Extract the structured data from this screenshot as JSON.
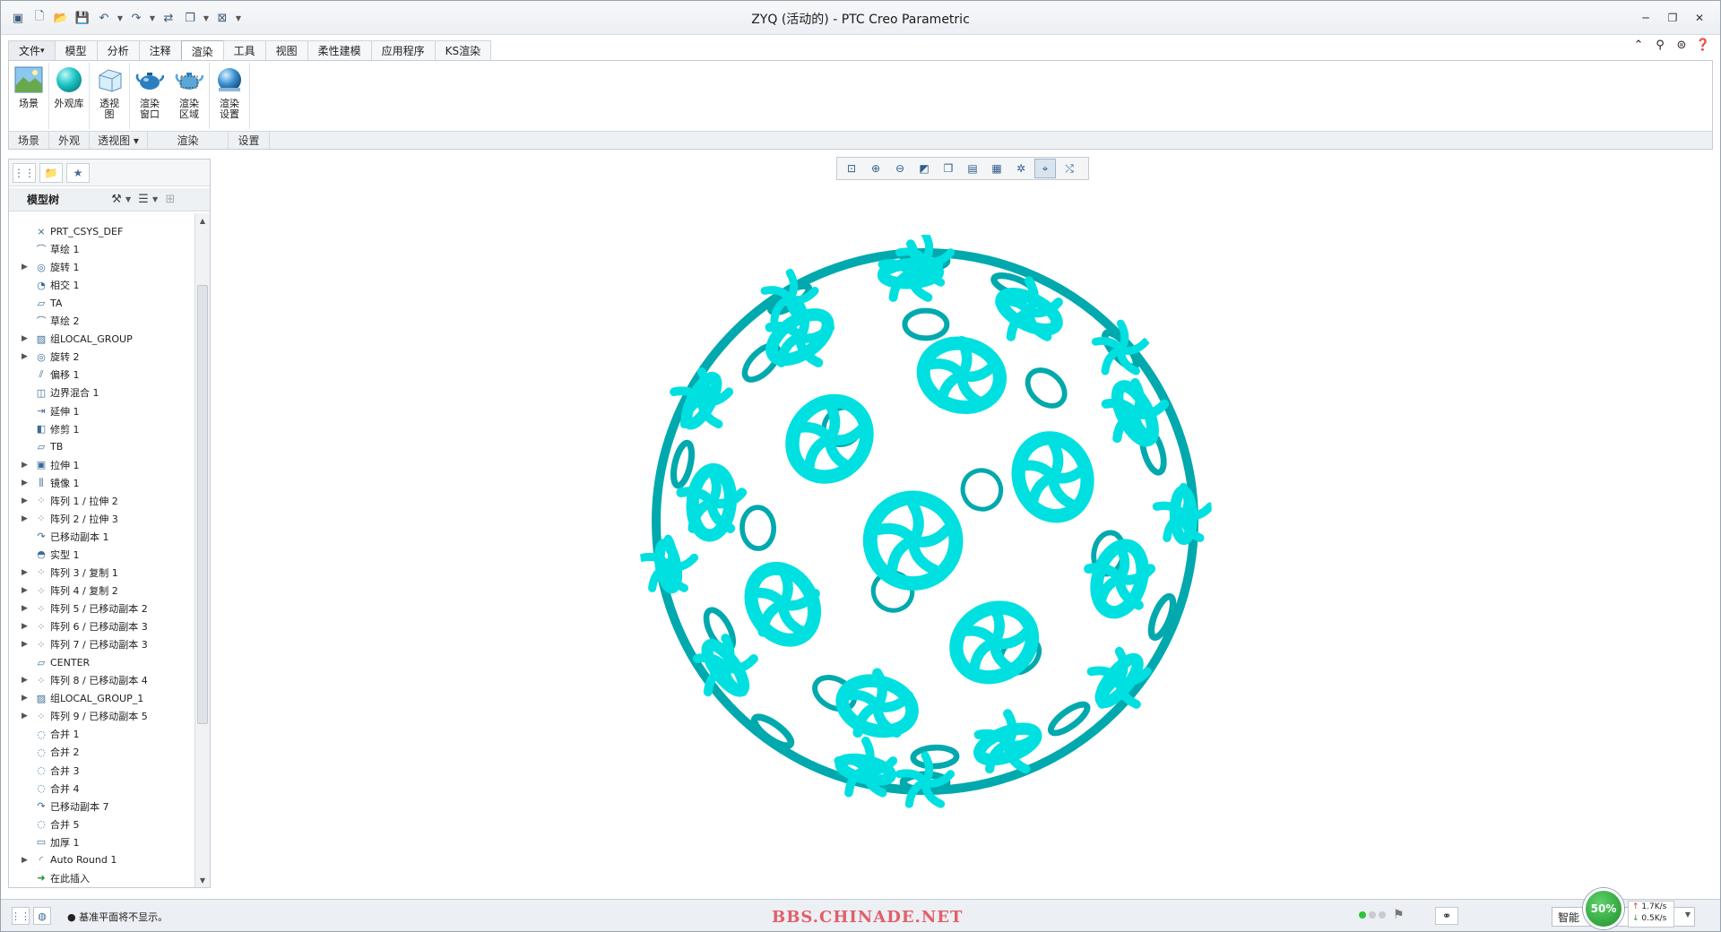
{
  "window": {
    "title": "ZYQ (活动的) - PTC Creo Parametric",
    "controls": [
      "minimize-icon",
      "restore-icon",
      "close-icon"
    ]
  },
  "quick_access": [
    "new-icon",
    "open-icon",
    "save-icon",
    "undo-icon",
    "redo-icon",
    "regenerate-icon",
    "windows-icon",
    "close-window-icon",
    "customize-icon"
  ],
  "tabs": [
    {
      "label": "文件",
      "dropdown": true
    },
    {
      "label": "模型"
    },
    {
      "label": "分析"
    },
    {
      "label": "注释"
    },
    {
      "label": "渲染",
      "active": true
    },
    {
      "label": "工具"
    },
    {
      "label": "视图"
    },
    {
      "label": "柔性建模"
    },
    {
      "label": "应用程序"
    },
    {
      "label": "KS渲染"
    }
  ],
  "ribbon": {
    "buttons": [
      {
        "label": "场景"
      },
      {
        "label": "外观库"
      },
      {
        "label": "透视\n图"
      },
      {
        "label": "渲染\n窗口"
      },
      {
        "label": "渲染\n区域"
      },
      {
        "label": "渲染\n设置"
      }
    ],
    "groups": [
      {
        "label": "场景"
      },
      {
        "label": "外观"
      },
      {
        "label": "透视图 ▾"
      },
      {
        "label": "渲染"
      },
      {
        "label": "设置"
      }
    ]
  },
  "model_tree": {
    "title": "模型树",
    "items": [
      {
        "label": "PRT_CSYS_DEF",
        "icon": "csys-icon",
        "expandable": false
      },
      {
        "label": "草绘 1",
        "icon": "sketch-icon",
        "expandable": false
      },
      {
        "label": "旋转 1",
        "icon": "revolve-icon",
        "expandable": true
      },
      {
        "label": "相交 1",
        "icon": "intersect-icon",
        "expandable": false
      },
      {
        "label": "TA",
        "icon": "plane-icon",
        "expandable": false
      },
      {
        "label": "草绘 2",
        "icon": "sketch-icon",
        "expandable": false
      },
      {
        "label": "组LOCAL_GROUP",
        "icon": "group-icon",
        "expandable": true
      },
      {
        "label": "旋转 2",
        "icon": "revolve-icon",
        "expandable": true
      },
      {
        "label": "偏移 1",
        "icon": "offset-icon",
        "expandable": false
      },
      {
        "label": "边界混合 1",
        "icon": "boundary-icon",
        "expandable": false
      },
      {
        "label": "延伸 1",
        "icon": "extend-icon",
        "expandable": false
      },
      {
        "label": "修剪 1",
        "icon": "trim-icon",
        "expandable": false
      },
      {
        "label": "TB",
        "icon": "plane-icon",
        "expandable": false
      },
      {
        "label": "拉伸 1",
        "icon": "extrude-icon",
        "expandable": true
      },
      {
        "label": "镜像 1",
        "icon": "mirror-icon",
        "expandable": true
      },
      {
        "label": "阵列 1 / 拉伸 2",
        "icon": "pattern-icon",
        "expandable": true
      },
      {
        "label": "阵列 2 / 拉伸 3",
        "icon": "pattern-icon",
        "expandable": true
      },
      {
        "label": "已移动副本 1",
        "icon": "moved-copy-icon",
        "expandable": false
      },
      {
        "label": "实型 1",
        "icon": "solidify-icon",
        "expandable": false
      },
      {
        "label": "阵列 3 / 复制 1",
        "icon": "pattern-icon",
        "expandable": true
      },
      {
        "label": "阵列 4 / 复制 2",
        "icon": "pattern-icon",
        "expandable": true
      },
      {
        "label": "阵列 5 / 已移动副本 2",
        "icon": "pattern-icon",
        "expandable": true
      },
      {
        "label": "阵列 6 / 已移动副本 3",
        "icon": "pattern-icon",
        "expandable": true
      },
      {
        "label": "阵列 7 / 已移动副本 3",
        "icon": "pattern-icon",
        "expandable": true
      },
      {
        "label": "CENTER",
        "icon": "plane-icon",
        "expandable": false
      },
      {
        "label": "阵列 8 / 已移动副本 4",
        "icon": "pattern-icon",
        "expandable": true
      },
      {
        "label": "组LOCAL_GROUP_1",
        "icon": "group-icon",
        "expandable": true
      },
      {
        "label": "阵列 9 / 已移动副本 5",
        "icon": "pattern-icon",
        "expandable": true
      },
      {
        "label": "合并 1",
        "icon": "merge-icon",
        "expandable": false
      },
      {
        "label": "合并 2",
        "icon": "merge-icon",
        "expandable": false
      },
      {
        "label": "合并 3",
        "icon": "merge-icon",
        "expandable": false
      },
      {
        "label": "合并 4",
        "icon": "merge-icon",
        "expandable": false
      },
      {
        "label": "已移动副本 7",
        "icon": "moved-copy-icon",
        "expandable": false
      },
      {
        "label": "合并 5",
        "icon": "merge-icon",
        "expandable": false
      },
      {
        "label": "加厚 1",
        "icon": "thicken-icon",
        "expandable": false
      },
      {
        "label": "Auto Round 1",
        "icon": "round-icon",
        "expandable": true
      },
      {
        "label": "在此插入",
        "icon": "insert-here-icon",
        "expandable": false
      }
    ]
  },
  "graphics_toolbar": [
    "refit-icon",
    "zoom-in-icon",
    "zoom-out-icon",
    "repaint-icon",
    "display-style-icon",
    "saved-views-icon",
    "view-manager-icon",
    "datum-display-icon",
    "spin-center-icon",
    "annotation-display-icon"
  ],
  "status": {
    "message": "基准平面将不显示。",
    "watermark": "BBS.CHINADE.NET",
    "filter": "智能",
    "cpu": "50%",
    "net_up": "1.7K/s",
    "net_down": "0.5K/s"
  },
  "colors": {
    "model": "#00e0e0",
    "accent": "#3b6d9e"
  }
}
